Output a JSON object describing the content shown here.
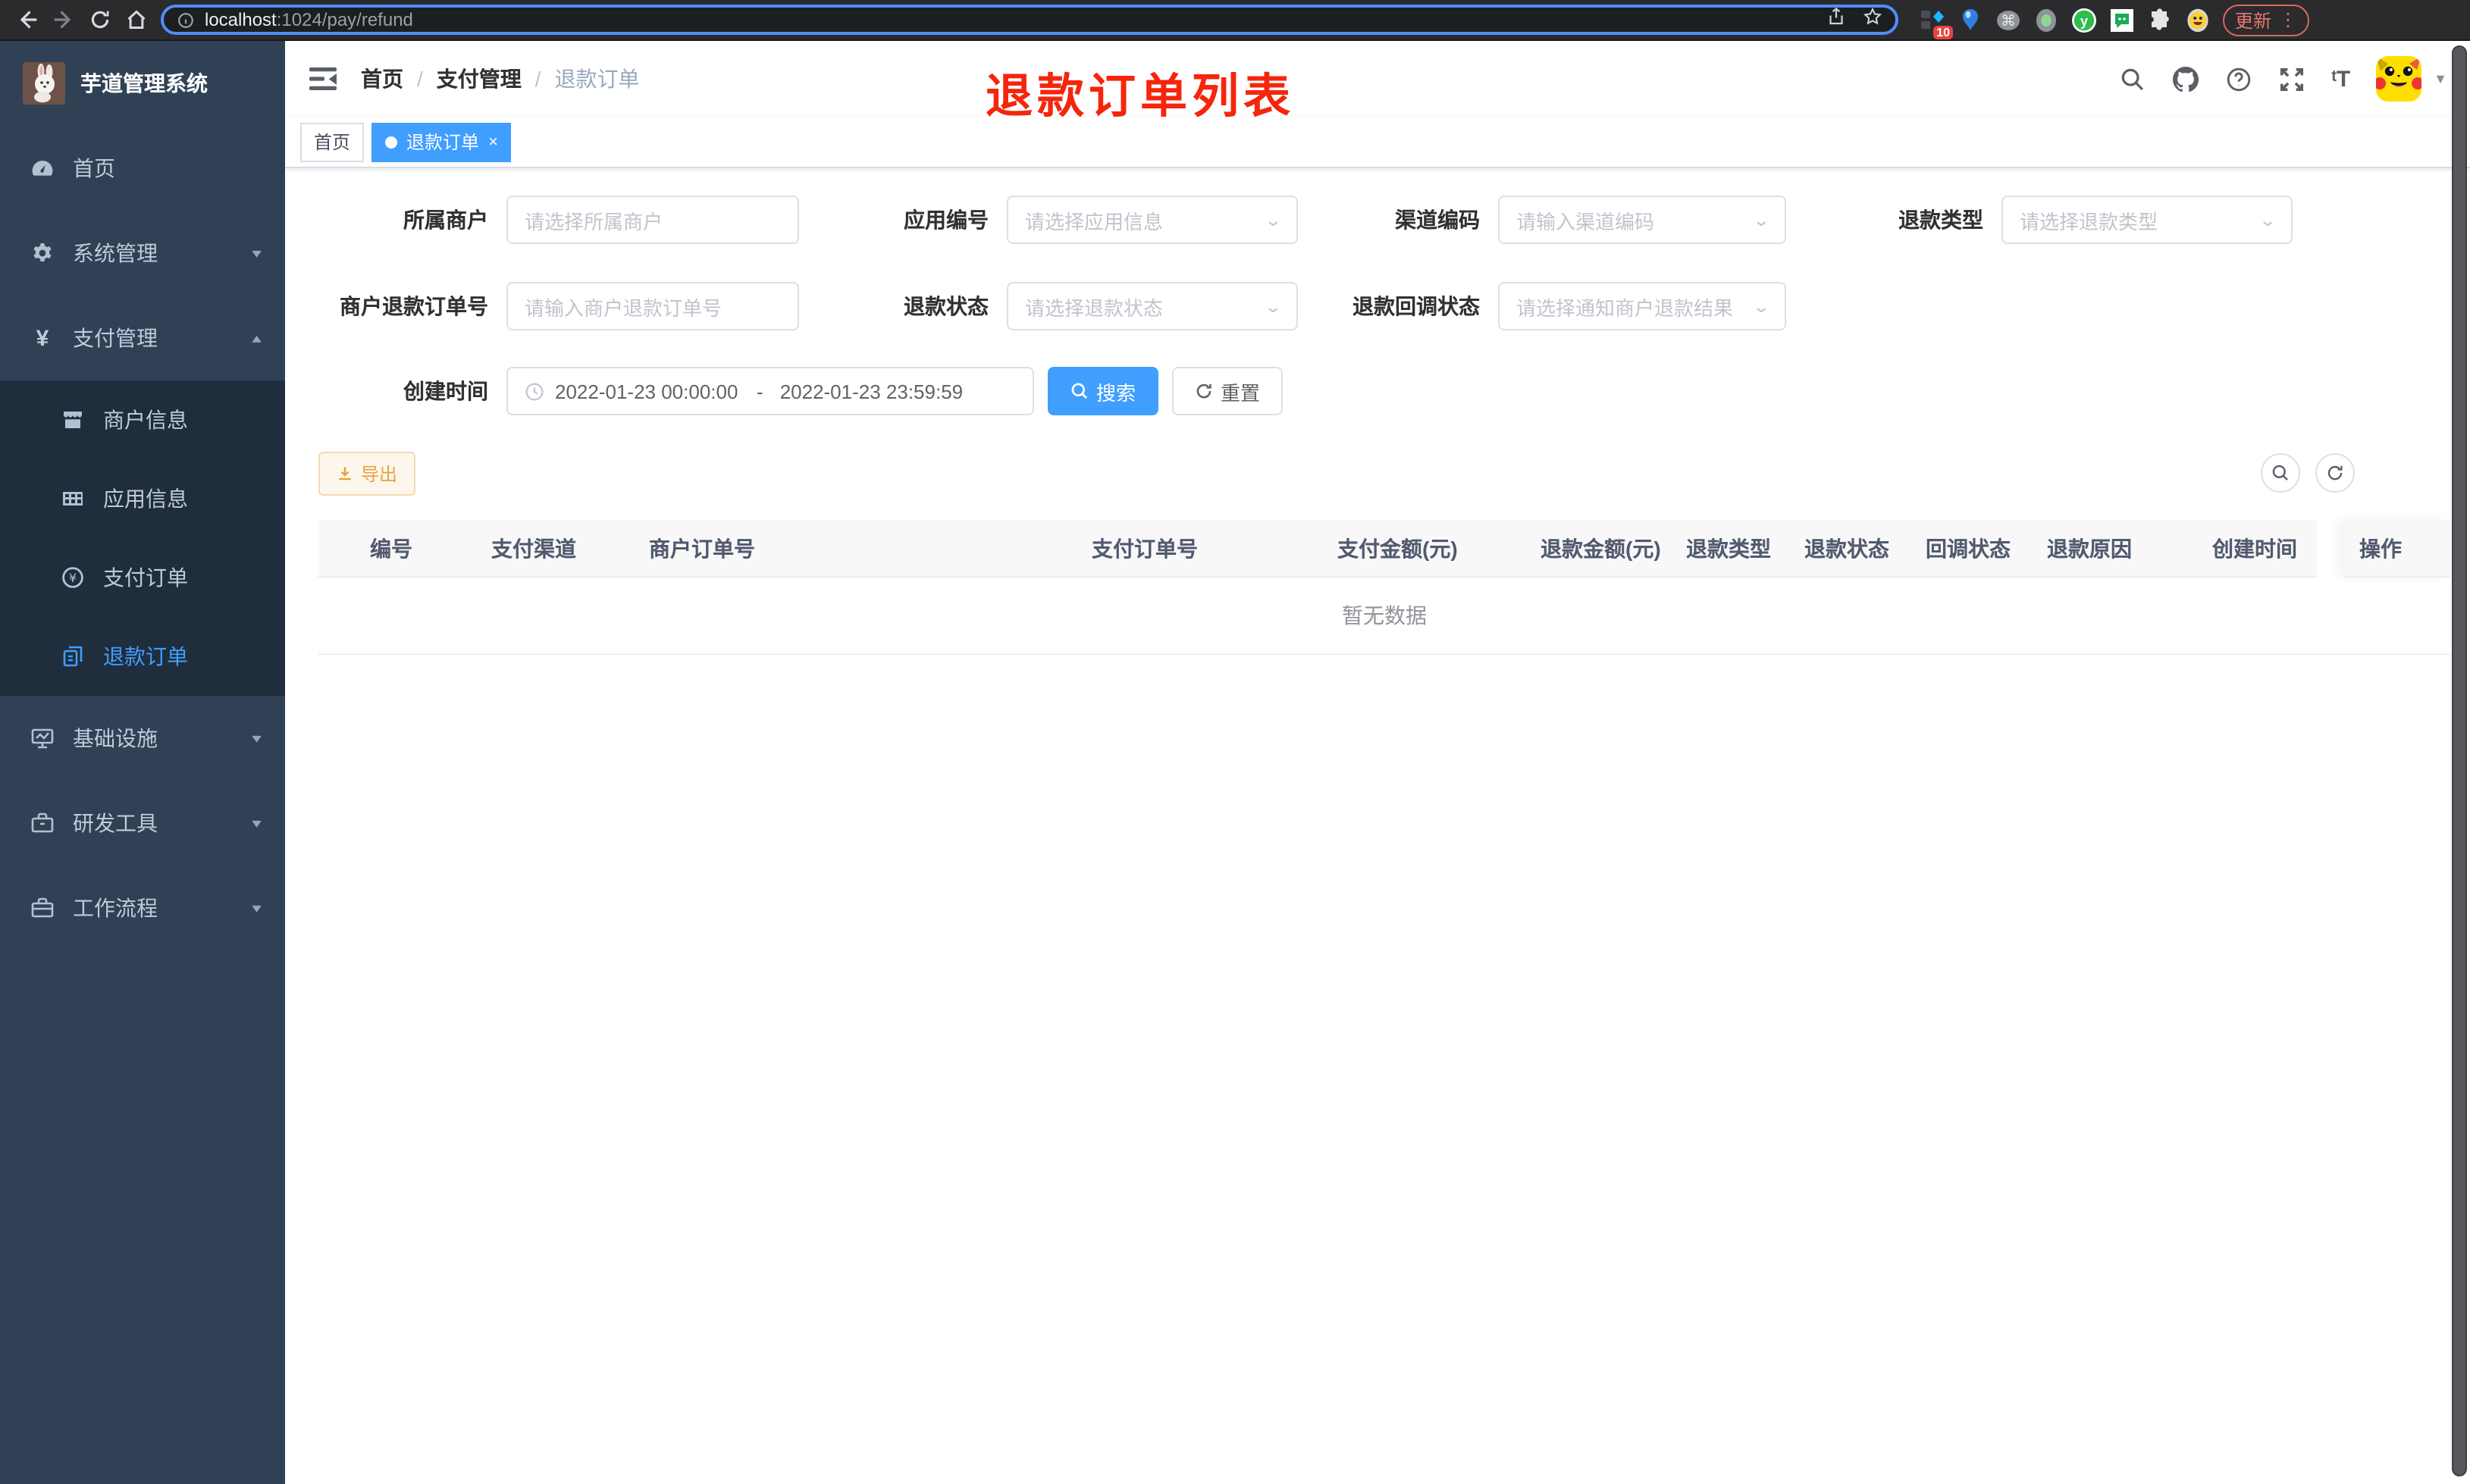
{
  "browser": {
    "url": {
      "host": "localhost",
      "rest": ":1024/pay/refund"
    },
    "extension_badge": "10",
    "update_button": "更新"
  },
  "sidebar": {
    "title": "芋道管理系统",
    "items": [
      {
        "label": "首页"
      },
      {
        "label": "系统管理"
      },
      {
        "label": "支付管理"
      },
      {
        "label": "商户信息"
      },
      {
        "label": "应用信息"
      },
      {
        "label": "支付订单"
      },
      {
        "label": "退款订单"
      },
      {
        "label": "基础设施"
      },
      {
        "label": "研发工具"
      },
      {
        "label": "工作流程"
      }
    ]
  },
  "navbar": {
    "breadcrumb": {
      "home": "首页",
      "section": "支付管理",
      "current": "退款订单"
    },
    "annotation": "退款订单列表"
  },
  "tags": {
    "home": "首页",
    "active": "退款订单",
    "close": "×"
  },
  "filters": {
    "merchant": {
      "label": "所属商户",
      "placeholder": "请选择所属商户"
    },
    "app_no": {
      "label": "应用编号",
      "placeholder": "请选择应用信息"
    },
    "channel_code": {
      "label": "渠道编码",
      "placeholder": "请输入渠道编码"
    },
    "refund_type": {
      "label": "退款类型",
      "placeholder": "请选择退款类型"
    },
    "merchant_refund_no": {
      "label": "商户退款订单号",
      "placeholder": "请输入商户退款订单号"
    },
    "refund_status": {
      "label": "退款状态",
      "placeholder": "请选择退款状态"
    },
    "notify_status": {
      "label": "退款回调状态",
      "placeholder": "请选择通知商户退款结果"
    },
    "create_time": {
      "label": "创建时间",
      "start": "2022-01-23 00:00:00",
      "separator": "-",
      "end": "2022-01-23 23:59:59"
    },
    "search": "搜索",
    "reset": "重置",
    "export": "导出"
  },
  "table": {
    "columns": [
      "编号",
      "支付渠道",
      "商户订单号",
      "支付订单号",
      "支付金额(元)",
      "退款金额(元)",
      "退款类型",
      "退款状态",
      "回调状态",
      "退款原因",
      "创建时间",
      "操作"
    ],
    "empty": "暂无数据"
  },
  "colors": {
    "accent": "#409eff",
    "annotation_red": "#f5260c",
    "warning": "#e6a23c",
    "sidebar_bg": "#304156",
    "submenu_bg": "#1f2d3d"
  }
}
